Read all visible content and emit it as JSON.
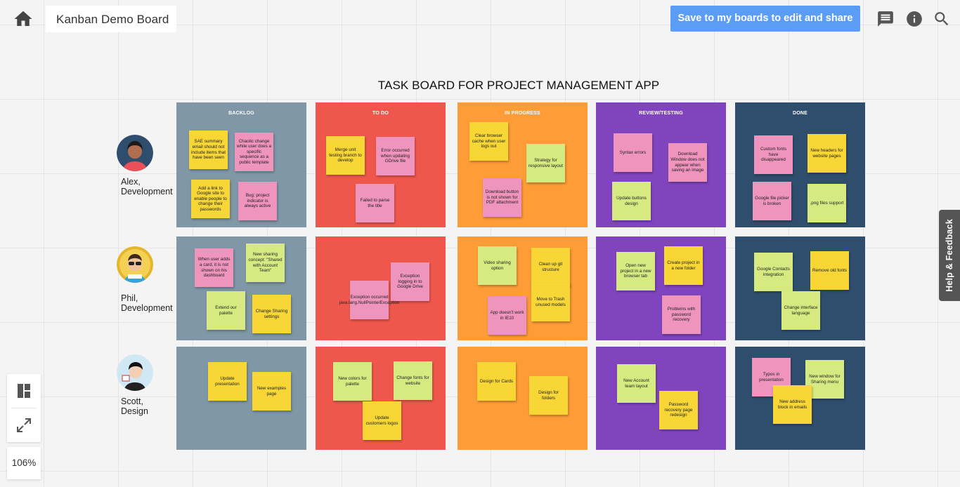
{
  "header": {
    "board_name": "Kanban Demo Board",
    "save_button": "Save to my boards to edit and share",
    "icons": [
      "home-icon",
      "comment-icon",
      "info-icon",
      "search-icon"
    ]
  },
  "board": {
    "title": "TASK BOARD FOR PROJECT MANAGEMENT APP",
    "columns": [
      {
        "name": "BACKLOG",
        "color": "#7f97a7"
      },
      {
        "name": "TO DO",
        "color": "#f0574c"
      },
      {
        "name": "IN PROGRESS",
        "color": "#fe9c37"
      },
      {
        "name": "REVIEW/TESTING",
        "color": "#8045be"
      },
      {
        "name": "DONE",
        "color": "#2f4e6d"
      }
    ],
    "rows": [
      {
        "name": "Alex,",
        "role": "Development"
      },
      {
        "name": "Phil,",
        "role": "Development"
      },
      {
        "name": "Scott,",
        "role": "Design"
      }
    ],
    "note_colors": {
      "yellow": "#f7d636",
      "pink": "#ef94bc",
      "green": "#d7ea82"
    },
    "notes": [
      {
        "text": "SAE summary email should not include items that have been seen",
        "color": "yellow",
        "row": 0,
        "col": 0
      },
      {
        "text": "Chaotic change while user does a specific sequence as a public template",
        "color": "pink",
        "row": 0,
        "col": 0
      },
      {
        "text": "Add a link to Google site to enable people to change their passwords",
        "color": "yellow",
        "row": 0,
        "col": 0
      },
      {
        "text": "Bug: project indicator is always active",
        "color": "pink",
        "row": 0,
        "col": 0
      },
      {
        "text": "Merge unit testing branch to develop",
        "color": "yellow",
        "row": 0,
        "col": 1
      },
      {
        "text": "Error occurred when updating GDrive file",
        "color": "pink",
        "row": 0,
        "col": 1
      },
      {
        "text": "Failed to parse the title",
        "color": "pink",
        "row": 0,
        "col": 1
      },
      {
        "text": "Clear browser cache when user logs out",
        "color": "yellow",
        "row": 0,
        "col": 2
      },
      {
        "text": "Strategy for responsive layout",
        "color": "green",
        "row": 0,
        "col": 2
      },
      {
        "text": "Download button is not shown for PDF attachment",
        "color": "pink",
        "row": 0,
        "col": 2
      },
      {
        "text": "Syntax errors",
        "color": "pink",
        "row": 0,
        "col": 3
      },
      {
        "text": "Download Window does not appear when saving an image",
        "color": "pink",
        "row": 0,
        "col": 3
      },
      {
        "text": "Update buttons design",
        "color": "green",
        "row": 0,
        "col": 3
      },
      {
        "text": "Custom fonts have disappeared",
        "color": "pink",
        "row": 0,
        "col": 4
      },
      {
        "text": "New headers for website pages",
        "color": "yellow",
        "row": 0,
        "col": 4
      },
      {
        "text": "Google file picker is broken",
        "color": "pink",
        "row": 0,
        "col": 4
      },
      {
        "text": ".png files support",
        "color": "green",
        "row": 0,
        "col": 4
      },
      {
        "text": "When user adds a card, it is not shown on his dashboard",
        "color": "pink",
        "row": 1,
        "col": 0
      },
      {
        "text": "New sharing concept: \"Shared with Account Team\"",
        "color": "green",
        "row": 1,
        "col": 0
      },
      {
        "text": "Extend our palette",
        "color": "green",
        "row": 1,
        "col": 0
      },
      {
        "text": "Change Sharing settings",
        "color": "yellow",
        "row": 1,
        "col": 0
      },
      {
        "text": "Exception logging in to Google Drive",
        "color": "pink",
        "row": 1,
        "col": 1
      },
      {
        "text": "Exception occurred java.lang.NullPointerException",
        "color": "pink",
        "row": 1,
        "col": 1
      },
      {
        "text": "Video sharing option",
        "color": "green",
        "row": 1,
        "col": 2
      },
      {
        "text": "Clean up git structure",
        "color": "yellow",
        "row": 1,
        "col": 2
      },
      {
        "text": "Move to Trash unused models",
        "color": "yellow",
        "row": 1,
        "col": 2
      },
      {
        "text": "App doesn't work in IE10",
        "color": "pink",
        "row": 1,
        "col": 2
      },
      {
        "text": "Open new project in a new browser tab",
        "color": "green",
        "row": 1,
        "col": 3
      },
      {
        "text": "Create project in a new folder",
        "color": "yellow",
        "row": 1,
        "col": 3
      },
      {
        "text": "Problems with password recovery",
        "color": "pink",
        "row": 1,
        "col": 3
      },
      {
        "text": "Google Contacts integration",
        "color": "green",
        "row": 1,
        "col": 4
      },
      {
        "text": "Remove old fonts",
        "color": "yellow",
        "row": 1,
        "col": 4
      },
      {
        "text": "Change interface language",
        "color": "green",
        "row": 1,
        "col": 4
      },
      {
        "text": "Update presentation",
        "color": "yellow",
        "row": 2,
        "col": 0
      },
      {
        "text": "New examples page",
        "color": "yellow",
        "row": 2,
        "col": 0
      },
      {
        "text": "New colors for palette",
        "color": "green",
        "row": 2,
        "col": 1
      },
      {
        "text": "Change fonts for website",
        "color": "green",
        "row": 2,
        "col": 1
      },
      {
        "text": "Update customers logos",
        "color": "yellow",
        "row": 2,
        "col": 1
      },
      {
        "text": "Design for Cards",
        "color": "yellow",
        "row": 2,
        "col": 2
      },
      {
        "text": "Design for folders",
        "color": "yellow",
        "row": 2,
        "col": 2
      },
      {
        "text": "New Account team layout",
        "color": "green",
        "row": 2,
        "col": 3
      },
      {
        "text": "Password recovery page redesign",
        "color": "yellow",
        "row": 2,
        "col": 3
      },
      {
        "text": "Typos in presentation",
        "color": "pink",
        "row": 2,
        "col": 4
      },
      {
        "text": "New window for Sharing menu",
        "color": "green",
        "row": 2,
        "col": 4
      },
      {
        "text": "New address block in emails",
        "color": "yellow",
        "row": 2,
        "col": 4
      }
    ]
  },
  "toolbar": {
    "icons": [
      "layout-icon",
      "fullscreen-icon"
    ],
    "zoom": "106%"
  },
  "help_tab": {
    "label": "Help & Feedback"
  }
}
